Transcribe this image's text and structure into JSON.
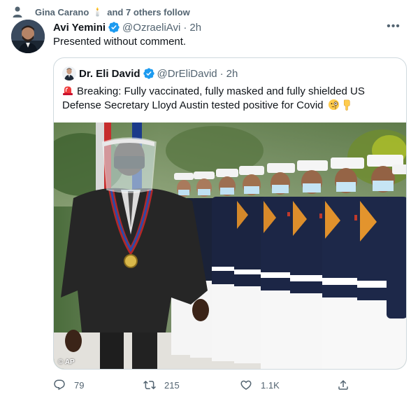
{
  "social_context": {
    "icon": "person-icon",
    "name": "Gina Carano",
    "emoji": "🕯️",
    "suffix": "and 7 others follow"
  },
  "tweet": {
    "author_name": "Avi Yemini",
    "author_handle": "@OzraeliAvi",
    "separator": "·",
    "time": "2h",
    "text": "Presented without comment.",
    "more_icon": "more-icon",
    "more_glyph": "•••"
  },
  "quote": {
    "author_name": "Dr. Eli David",
    "author_handle": "@DrEliDavid",
    "separator": "·",
    "time": "2h",
    "text": "Breaking: Fully vaccinated, fully masked and fully shielded US Defense Secretary Lloyd Austin tested positive for Covid",
    "media_credit": "© AP"
  },
  "actions": {
    "replies": "79",
    "retweets": "215",
    "likes": "1.1K"
  },
  "colors": {
    "accent": "#1d9bf0",
    "secondary_text": "#536471",
    "border": "#cfd9de"
  }
}
